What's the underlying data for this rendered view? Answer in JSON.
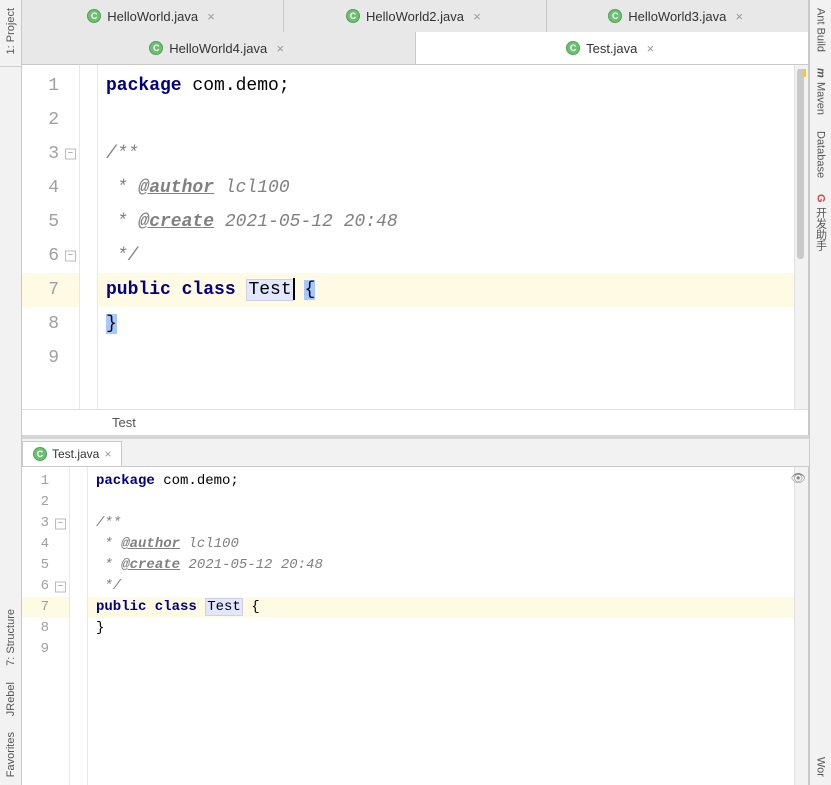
{
  "left_rail": [
    {
      "label": "1: Project",
      "icon": "project"
    },
    {
      "label": "7: Structure",
      "icon": "structure"
    },
    {
      "label": "JRebel",
      "icon": "jrebel"
    },
    {
      "label": "Favorites",
      "icon": "favorites"
    }
  ],
  "right_rail": [
    {
      "label": "Ant Build",
      "icon": "ant"
    },
    {
      "label": "Maven",
      "icon": "maven",
      "icon_text": "m"
    },
    {
      "label": "Database",
      "icon": "database"
    },
    {
      "label": "开发助手",
      "icon": "dev-assist",
      "icon_text": "G"
    },
    {
      "label": "Wor",
      "icon": "work"
    }
  ],
  "tabs_row1": [
    {
      "file": "HelloWorld.java",
      "icon": "class",
      "closable": true
    },
    {
      "file": "HelloWorld2.java",
      "icon": "class",
      "closable": true
    },
    {
      "file": "HelloWorld3.java",
      "icon": "class",
      "closable": true
    }
  ],
  "tabs_row2": [
    {
      "file": "HelloWorld4.java",
      "icon": "class",
      "closable": true,
      "active": false
    },
    {
      "file": "Test.java",
      "icon": "class",
      "closable": true,
      "active": true
    }
  ],
  "editor_top": {
    "lines": [
      {
        "n": 1,
        "tokens": [
          {
            "t": "package ",
            "c": "kw"
          },
          {
            "t": "com.demo;"
          }
        ]
      },
      {
        "n": 2,
        "tokens": []
      },
      {
        "n": 3,
        "fold": "start",
        "tokens": [
          {
            "t": "/**",
            "c": "doc"
          }
        ]
      },
      {
        "n": 4,
        "tokens": [
          {
            "t": " * ",
            "c": "doc"
          },
          {
            "t": "@author",
            "c": "doctag"
          },
          {
            "t": " lcl100",
            "c": "doc"
          }
        ]
      },
      {
        "n": 5,
        "tokens": [
          {
            "t": " * ",
            "c": "doc"
          },
          {
            "t": "@create",
            "c": "doctag"
          },
          {
            "t": " 2021-05-12 20:48",
            "c": "doc"
          }
        ]
      },
      {
        "n": 6,
        "fold": "end",
        "tokens": [
          {
            "t": " */",
            "c": "doc"
          }
        ]
      },
      {
        "n": 7,
        "hl": true,
        "tokens": [
          {
            "t": "public class ",
            "c": "kw"
          },
          {
            "t": "Test",
            "c": "hl-usage"
          },
          {
            "caret": true
          },
          {
            "t": " "
          },
          {
            "t": "{",
            "c": "sel"
          }
        ]
      },
      {
        "n": 8,
        "tokens": [
          {
            "t": "}",
            "c": "sel"
          }
        ]
      },
      {
        "n": 9,
        "tokens": []
      }
    ],
    "line_height": 34,
    "breadcrumb": "Test"
  },
  "sub_tab": {
    "file": "Test.java",
    "icon": "class"
  },
  "editor_bottom": {
    "lines": [
      {
        "n": 1,
        "tokens": [
          {
            "t": "package ",
            "c": "kw"
          },
          {
            "t": "com.demo;"
          }
        ]
      },
      {
        "n": 2,
        "tokens": []
      },
      {
        "n": 3,
        "fold": "start",
        "tokens": [
          {
            "t": "/**",
            "c": "doc"
          }
        ]
      },
      {
        "n": 4,
        "tokens": [
          {
            "t": " * ",
            "c": "doc"
          },
          {
            "t": "@author",
            "c": "doctag"
          },
          {
            "t": " lcl100",
            "c": "doc"
          }
        ]
      },
      {
        "n": 5,
        "tokens": [
          {
            "t": " * ",
            "c": "doc"
          },
          {
            "t": "@create",
            "c": "doctag"
          },
          {
            "t": " 2021-05-12 20:48",
            "c": "doc"
          }
        ]
      },
      {
        "n": 6,
        "fold": "end",
        "tokens": [
          {
            "t": " */",
            "c": "doc"
          }
        ]
      },
      {
        "n": 7,
        "hl": true,
        "tokens": [
          {
            "t": "public class ",
            "c": "kw"
          },
          {
            "t": "Test",
            "c": "hl-usage"
          },
          {
            "t": " {"
          }
        ]
      },
      {
        "n": 8,
        "tokens": [
          {
            "t": "}"
          }
        ]
      },
      {
        "n": 9,
        "tokens": []
      }
    ],
    "line_height": 21
  },
  "class_icon_letter": "C",
  "close_glyph": "×",
  "eye_glyph": "👁"
}
